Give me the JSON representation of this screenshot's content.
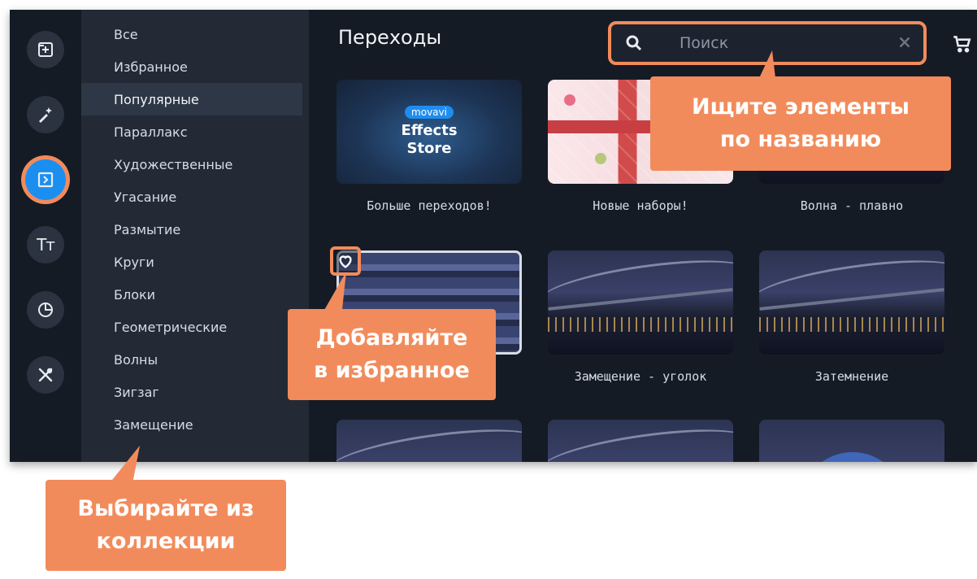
{
  "app": {
    "rail": [
      {
        "name": "import-icon",
        "active": false
      },
      {
        "name": "effects-wand-icon",
        "active": false
      },
      {
        "name": "transitions-icon",
        "active": true
      },
      {
        "name": "titles-icon",
        "active": false,
        "glyph": "Tт"
      },
      {
        "name": "stickers-icon",
        "active": false
      },
      {
        "name": "tools-icon",
        "active": false
      }
    ],
    "categories": [
      "Все",
      "Избранное",
      "Популярные",
      "Параллакс",
      "Художественные",
      "Угасание",
      "Размытие",
      "Круги",
      "Блоки",
      "Геометрические",
      "Волны",
      "Зигзаг",
      "Замещение"
    ],
    "selected_category": "Популярные",
    "main": {
      "title": "Переходы",
      "search": {
        "placeholder": "Поиск",
        "value": ""
      },
      "store_tile": {
        "badge": "movavi",
        "line1": "Effects",
        "line2": "Store"
      },
      "tiles": [
        {
          "label": "Больше переходов!"
        },
        {
          "label": "Новые наборы!"
        },
        {
          "label": "Волна - плавно"
        },
        {
          "label": ""
        },
        {
          "label": "Замещение - уголок"
        },
        {
          "label": "Затемнение"
        }
      ]
    }
  },
  "callouts": {
    "search": "Ищите элементы\nпо названию",
    "favorites": "Добавляйте\nв избранное",
    "collection": "Выбирайте из\nколлекции"
  },
  "colors": {
    "accent": "#f28b5b",
    "active_blue": "#1b8ff0",
    "app_bg": "#151b24",
    "sidebar_bg": "#232a36"
  }
}
